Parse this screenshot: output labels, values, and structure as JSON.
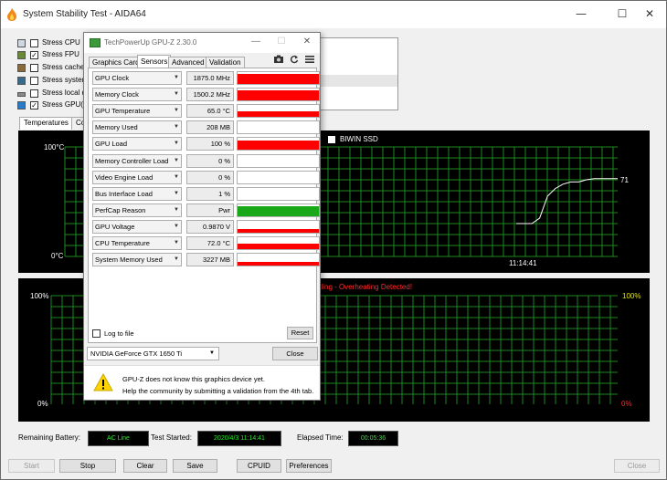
{
  "aida": {
    "title": "System Stability Test - AIDA64",
    "window_controls": {
      "minimize": "—",
      "maximize": "☐",
      "close": "✕"
    },
    "stress_items": [
      {
        "label": "Stress CPU",
        "checked": false
      },
      {
        "label": "Stress FPU",
        "checked": true
      },
      {
        "label": "Stress cache",
        "checked": false
      },
      {
        "label": "Stress system",
        "checked": false
      },
      {
        "label": "Stress local di",
        "checked": false
      },
      {
        "label": "Stress GPU(s)",
        "checked": true
      }
    ],
    "tabs": [
      "Temperatures",
      "Co"
    ],
    "graph1": {
      "top_label": "100°C",
      "bottom_label": "0°C",
      "legend_label": "BIWIN SSD",
      "time_label": "11:14:41",
      "end_value": "71",
      "series": [
        {
          "t": 0,
          "v": 30
        },
        {
          "t": 1,
          "v": 30
        },
        {
          "t": 2,
          "v": 30
        },
        {
          "t": 3,
          "v": 35
        },
        {
          "t": 4,
          "v": 55
        },
        {
          "t": 5,
          "v": 62
        },
        {
          "t": 6,
          "v": 66
        },
        {
          "t": 7,
          "v": 68
        },
        {
          "t": 8,
          "v": 68
        },
        {
          "t": 9,
          "v": 70
        },
        {
          "t": 10,
          "v": 71
        },
        {
          "t": 11,
          "v": 71
        },
        {
          "t": 12,
          "v": 71
        },
        {
          "t": 13,
          "v": 71
        }
      ]
    },
    "graph2": {
      "top_left": "100%",
      "bottom_left": "0%",
      "top_right": "100%",
      "bottom_right": "0%",
      "alert": "ttling - Overheating Detected!"
    },
    "footer": {
      "battery_label": "Remaining Battery:",
      "battery_value": "AC Line",
      "started_label": "Test Started:",
      "started_value": "2020/4/3 11:14:41",
      "elapsed_label": "Elapsed Time:",
      "elapsed_value": "00:05:36"
    },
    "buttons": {
      "start": "Start",
      "stop": "Stop",
      "clear": "Clear",
      "save": "Save",
      "cpuid": "CPUID",
      "preferences": "Preferences",
      "close": "Close"
    }
  },
  "gpuz": {
    "title": "TechPowerUp GPU-Z 2.30.0",
    "tabs": [
      "Graphics Card",
      "Sensors",
      "Advanced",
      "Validation"
    ],
    "active_tab": "Sensors",
    "sensors": [
      {
        "name": "GPU Clock",
        "value": "1875.0 MHz",
        "level": 0.85,
        "color": "#ff0000"
      },
      {
        "name": "Memory Clock",
        "value": "1500.2 MHz",
        "level": 0.85,
        "color": "#ff0000"
      },
      {
        "name": "GPU Temperature",
        "value": "65.0 °C",
        "level": 0.45,
        "color": "#ff0000"
      },
      {
        "name": "Memory Used",
        "value": "208 MB",
        "level": 0.0,
        "color": "#ff0000"
      },
      {
        "name": "GPU Load",
        "value": "100 %",
        "level": 0.8,
        "color": "#ff0000"
      },
      {
        "name": "Memory Controller Load",
        "value": "0 %",
        "level": 0.0,
        "color": "#ff0000"
      },
      {
        "name": "Video Engine Load",
        "value": "0 %",
        "level": 0.0,
        "color": "#ff0000"
      },
      {
        "name": "Bus Interface Load",
        "value": "1 %",
        "level": 0.0,
        "color": "#ff0000"
      },
      {
        "name": "PerfCap Reason",
        "value": "Pwr",
        "level": 0.85,
        "color": "#18a818"
      },
      {
        "name": "GPU Voltage",
        "value": "0.9870 V",
        "level": 0.3,
        "color": "#ff0000"
      },
      {
        "name": "CPU Temperature",
        "value": "72.0 °C",
        "level": 0.45,
        "color": "#ff0000"
      },
      {
        "name": "System Memory Used",
        "value": "3227 MB",
        "level": 0.3,
        "color": "#ff0000"
      }
    ],
    "log_label": "Log to file",
    "reset": "Reset",
    "device": "NVIDIA GeForce GTX 1650 Ti",
    "close": "Close",
    "warning_line1": "GPU-Z does not know this graphics device yet.",
    "warning_line2": "Help the community by submitting a validation from the 4th tab."
  }
}
